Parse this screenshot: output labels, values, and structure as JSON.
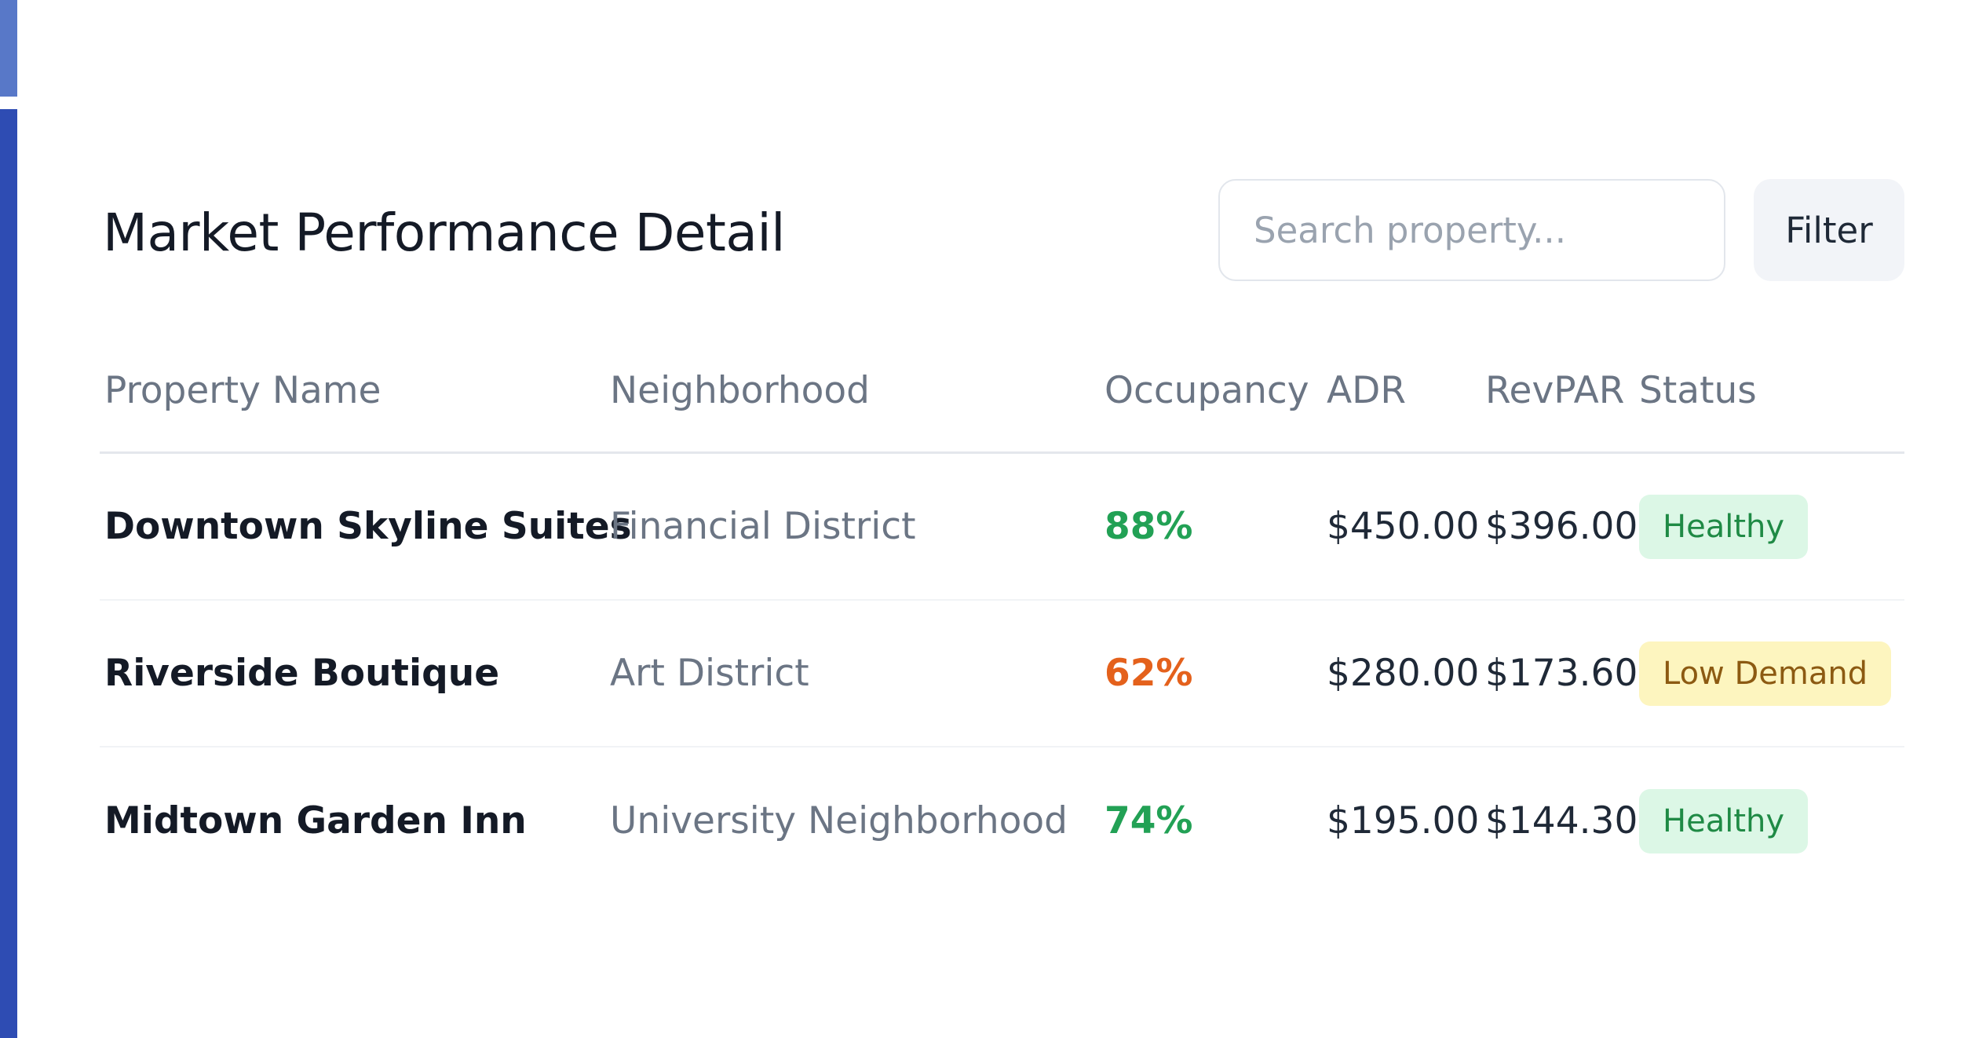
{
  "header": {
    "title": "Market Performance Detail",
    "search_placeholder": "Search property...",
    "filter_label": "Filter"
  },
  "table": {
    "columns": [
      "Property Name",
      "Neighborhood",
      "Occupancy",
      "ADR",
      "RevPAR",
      "Status"
    ],
    "rows": [
      {
        "name": "Downtown Skyline Suites",
        "neighborhood": "Financial District",
        "occupancy": "88%",
        "adr": "$450.00",
        "revpar": "$396.00",
        "status": "Healthy"
      },
      {
        "name": "Riverside Boutique",
        "neighborhood": "Art District",
        "occupancy": "62%",
        "adr": "$280.00",
        "revpar": "$173.60",
        "status": "Low Demand"
      },
      {
        "name": "Midtown Garden Inn",
        "neighborhood": "University Neighborhood",
        "occupancy": "74%",
        "adr": "$195.00",
        "revpar": "$144.30",
        "status": "Healthy"
      }
    ]
  },
  "colors": {
    "accent_bar": "#2e4cb3",
    "occupancy_good": "#22a155",
    "occupancy_low": "#e4611c",
    "badge_healthy_bg": "#dcf7e6",
    "badge_low_bg": "#fdf5bf"
  }
}
